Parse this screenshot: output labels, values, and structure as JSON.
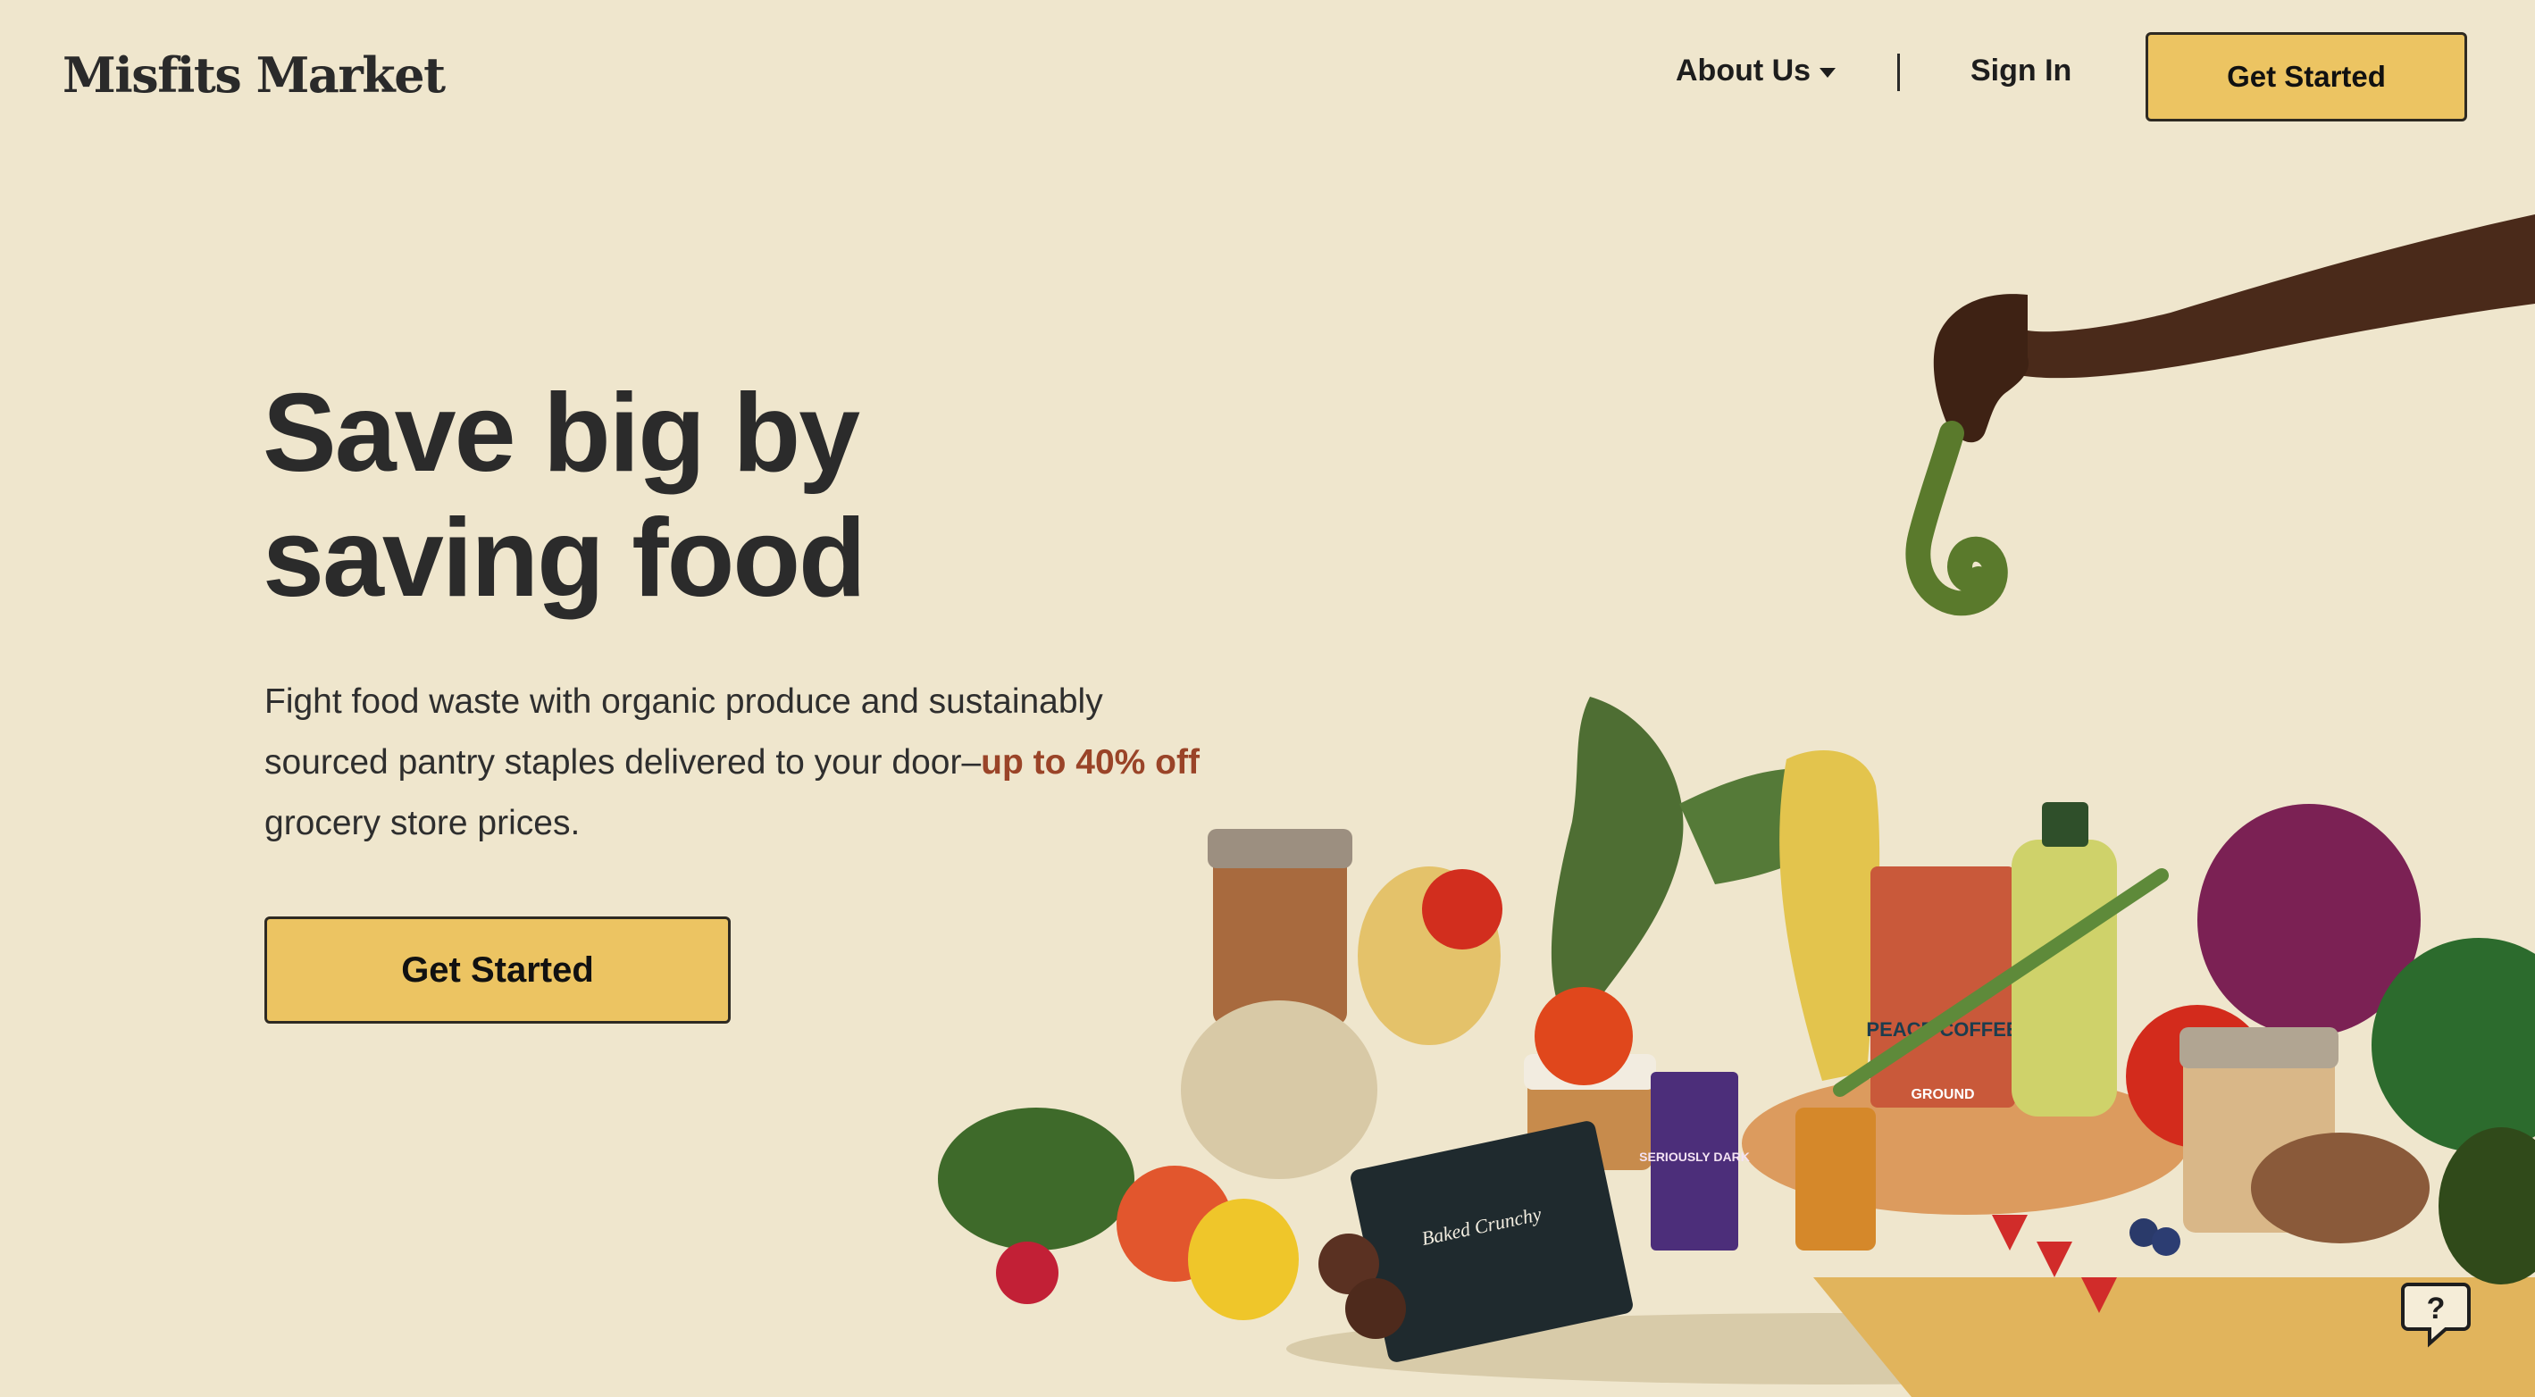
{
  "header": {
    "logo": "Misfits Market",
    "nav": {
      "about_label": "About Us",
      "signin_label": "Sign In"
    },
    "cta_label": "Get Started"
  },
  "hero": {
    "title_line1": "Save big by",
    "title_line2": "saving food",
    "body_part1": "Fight food waste with organic produce and sustainably sourced pantry staples delivered to your door–",
    "body_highlight": "up to 40% off",
    "body_part2": " grocery store prices.",
    "cta_label": "Get Started"
  },
  "image_text": {
    "coffee_bag": "PEACE COFFEE",
    "coffee_sub": "GROUND",
    "chocolate": "SERIOUSLY DARK",
    "chips": "Baked Crunchy"
  },
  "colors": {
    "background": "#efe6cd",
    "accent_button": "#ecc462",
    "highlight_text": "#9a4428"
  },
  "icons": {
    "dropdown": "caret-down-icon",
    "help": "help-chat-icon"
  }
}
